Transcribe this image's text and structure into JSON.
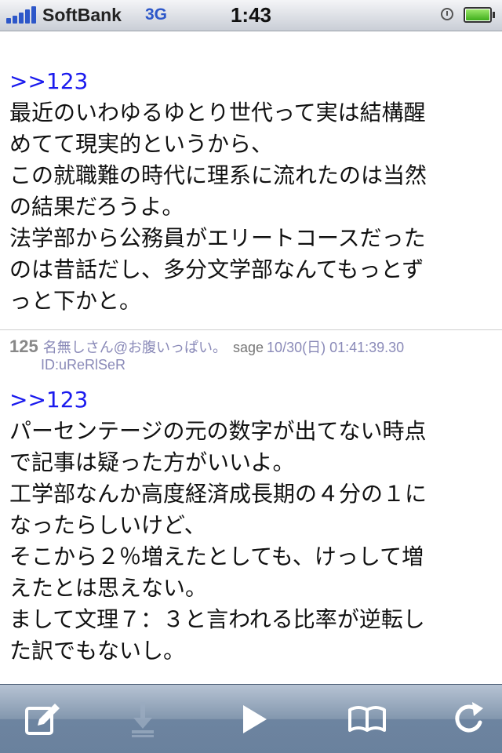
{
  "status_bar": {
    "carrier": "SoftBank",
    "network": "3G",
    "time": "1:43",
    "icons": [
      "signal-icon",
      "alarm-icon",
      "battery-icon"
    ]
  },
  "post_upper": {
    "anchor": ">>123",
    "lines": [
      "最近のいわゆるゆとり世代って実は結構醒",
      "めてて現実的というから、",
      "この就職難の時代に理系に流れたのは当然",
      "の結果だろうよ。",
      "法学部から公務員がエリートコースだった",
      "のは昔話だし、多分文学部なんてもっとず",
      "っと下かと。"
    ]
  },
  "post_125": {
    "number": "125",
    "name": "名無しさん@お腹いっぱい。",
    "mail": "sage",
    "date": "10/30(日) 01:41:39.30",
    "id": "ID:uReRlSeR",
    "anchor": ">>123",
    "lines": [
      "パーセンテージの元の数字が出てない時点",
      "で記事は疑った方がいいよ。",
      "工学部なんか高度経済成長期の４分の１に",
      "なったらしいけど、",
      "そこから２％増えたとしても、けっして増",
      "えたとは思えない。",
      "まして文理７：３と言われる比率が逆転し",
      "た訳でもないし。"
    ]
  },
  "toolbar": {
    "icons": [
      "compose-icon",
      "download-icon",
      "forward-icon",
      "bookmarks-icon",
      "reload-icon"
    ],
    "disabled": [
      "download-icon"
    ]
  },
  "colors": {
    "anchor": "#1a1aee",
    "meta": "#8a8ab8",
    "toolbar": "#8397ae",
    "network": "#2d57c9"
  }
}
